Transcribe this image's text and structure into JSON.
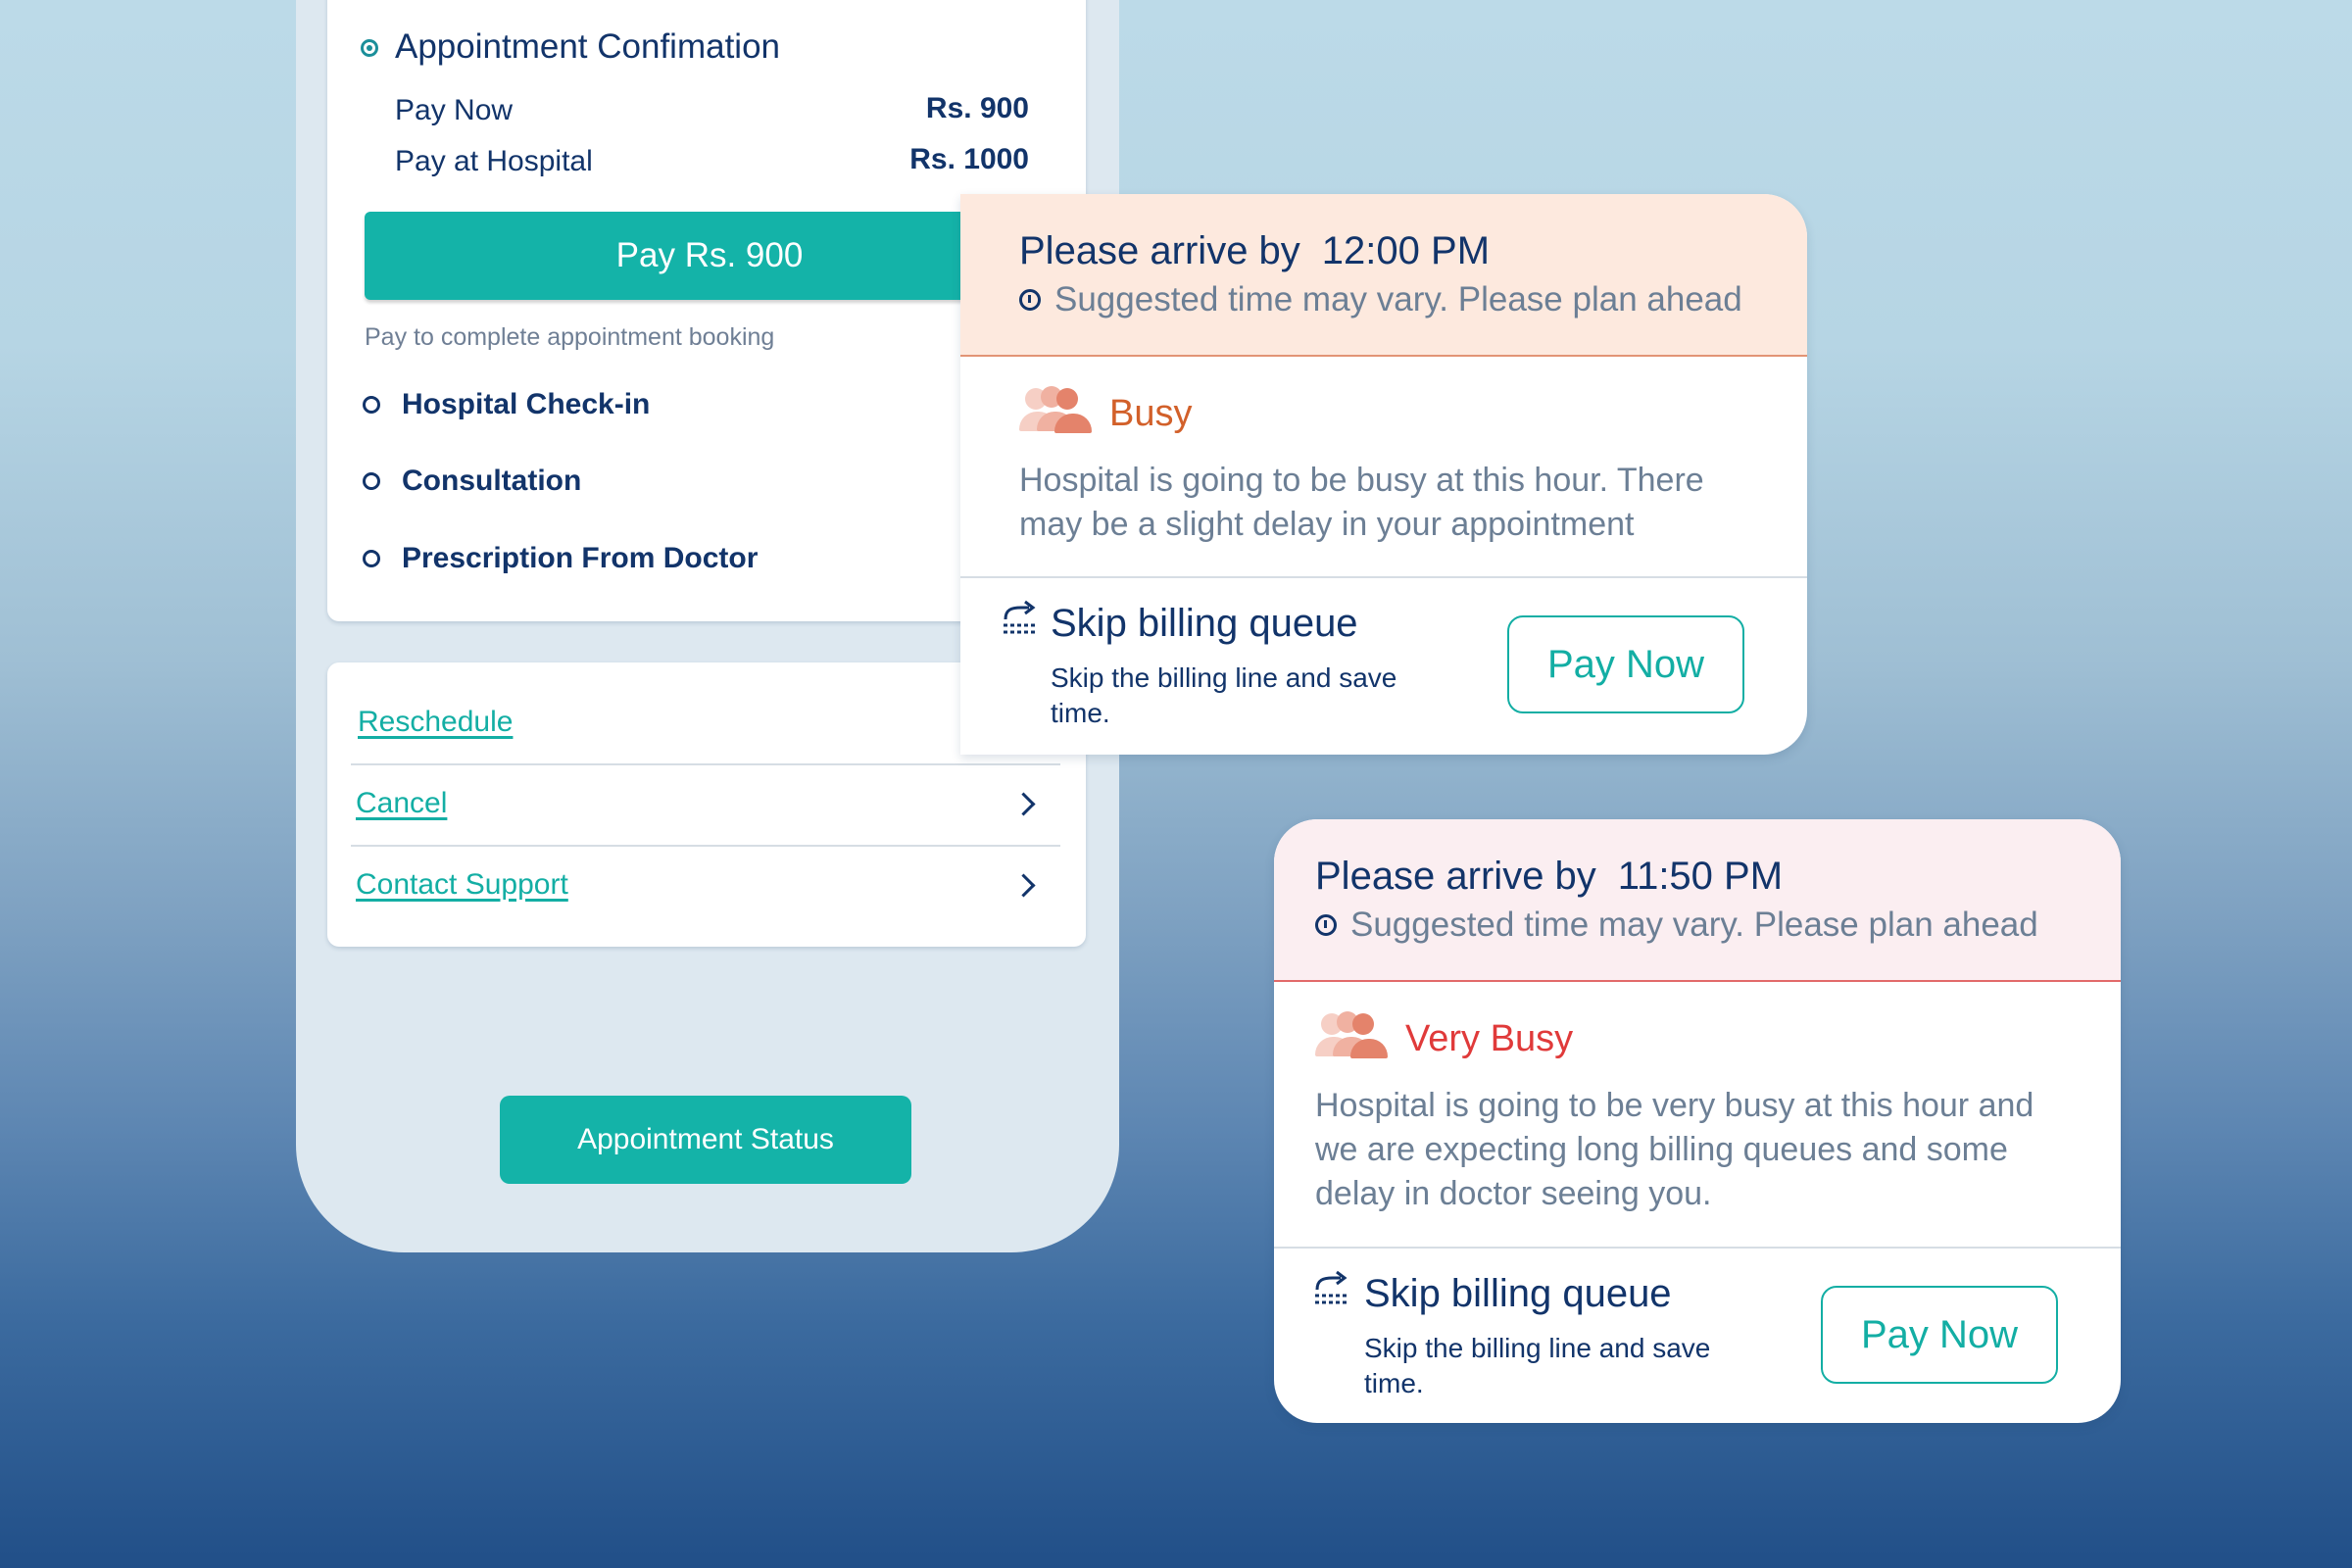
{
  "appointment": {
    "title": "Appointment Confimation",
    "pay_now_label": "Pay Now",
    "pay_now_amount": "Rs. 900",
    "pay_hospital_label": "Pay at Hospital",
    "pay_hospital_amount": "Rs. 1000",
    "pay_button": "Pay Rs. 900",
    "hint": "Pay to complete appointment booking",
    "steps": [
      "Hospital Check-in",
      "Consultation",
      "Prescription From Doctor"
    ]
  },
  "actions": {
    "reschedule": "Reschedule",
    "cancel": "Cancel",
    "contact_support": "Contact Support"
  },
  "status_button": "Appointment Status",
  "notices": [
    {
      "arrive_prefix": "Please arrive by",
      "arrive_time": "12:00 PM",
      "note": "Suggested time may vary. Please plan ahead",
      "level": "Busy",
      "level_color": "#d2602a",
      "description": "Hospital is going to be busy at this hour. There may be a slight delay in your appointment",
      "skip_title": "Skip billing queue",
      "skip_desc": "Skip the billing line and save time.",
      "pay_now": "Pay Now"
    },
    {
      "arrive_prefix": "Please arrive by",
      "arrive_time": "11:50 PM",
      "note": "Suggested time may vary. Please plan ahead",
      "level": "Very Busy",
      "level_color": "#e03a3a",
      "description": "Hospital is going to be very busy at this hour and we are expecting long billing queues and some delay in doctor seeing you.",
      "skip_title": "Skip billing queue",
      "skip_desc": "Skip the billing line and save time.",
      "pay_now": "Pay Now"
    }
  ],
  "colors": {
    "accent": "#14b3a8",
    "navy": "#12346a"
  }
}
